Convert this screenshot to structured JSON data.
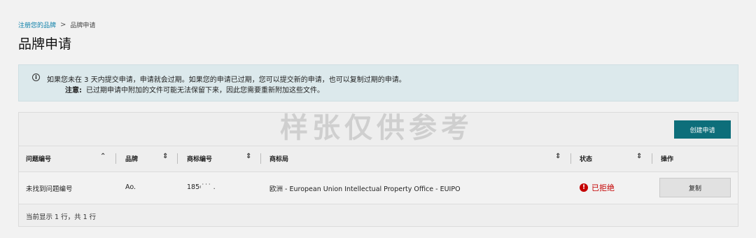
{
  "breadcrumb": {
    "parent": "注册您的品牌",
    "separator": ">",
    "current": "品牌申请"
  },
  "page_title": "品牌申请",
  "notice": {
    "icon": "info-icon",
    "line1": "如果您未在 3 天内提交申请，申请就会过期。如果您的申请已过期，您可以提交新的申请，也可以复制过期的申请。",
    "note_label": "注意:",
    "note_text": "已过期申请中附加的文件可能无法保留下来，因此您需要重新附加这些文件。"
  },
  "watermark": "样张仅供参考",
  "toolbar": {
    "create_label": "创建申请"
  },
  "table": {
    "columns": [
      "问题编号",
      "品牌",
      "商标编号",
      "商标局",
      "状态",
      "操作"
    ],
    "rows": [
      {
        "issue_no": "未找到问题编号",
        "brand": "Ao.",
        "trademark_no": "185፡˙˙˙ .",
        "office": "欧洲 - European Union Intellectual Property Office - EUIPO",
        "status": "已拒绝",
        "action": "复制"
      }
    ],
    "footer": "当前显示 1 行，共 1 行"
  },
  "colors": {
    "accent": "#0d6e7a",
    "status_rejected": "#c40000",
    "notice_bg": "#dce9ec"
  }
}
